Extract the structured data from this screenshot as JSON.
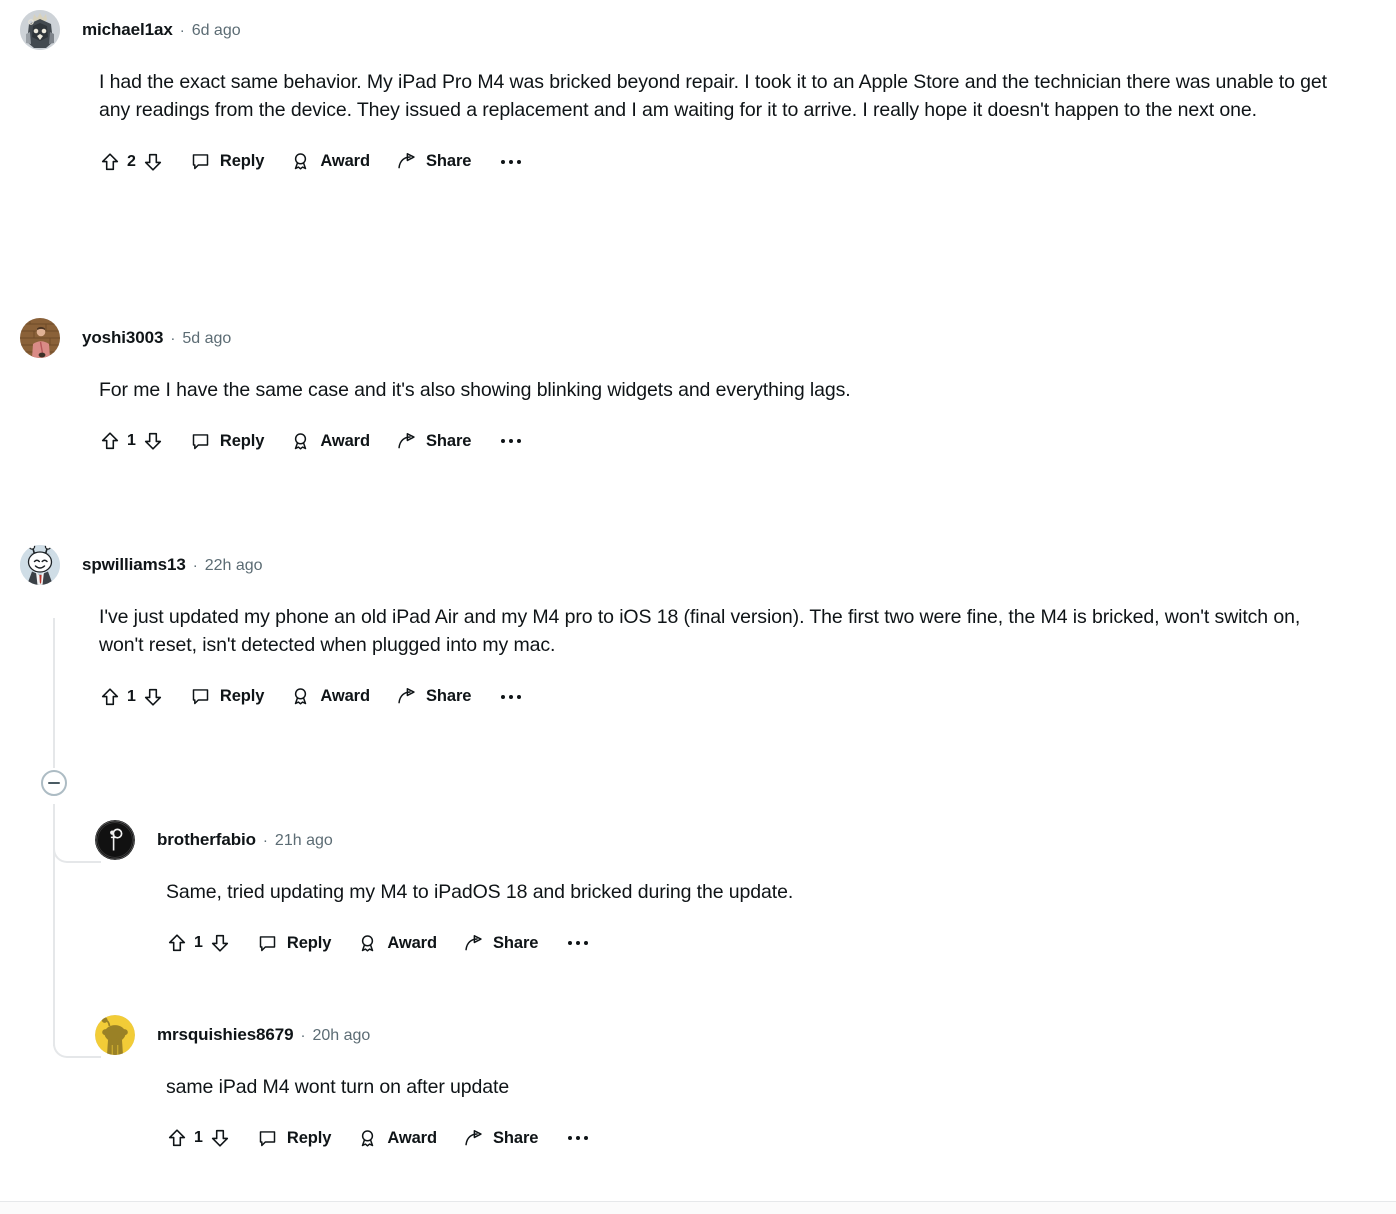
{
  "app": {
    "name": "reddit-comment-thread"
  },
  "action_labels": {
    "reply": "Reply",
    "award": "Award",
    "share": "Share",
    "more": "•••"
  },
  "separator": "·",
  "comments": [
    {
      "id": "c1",
      "username": "michael1ax",
      "timestamp": "6d ago",
      "score": "2",
      "body": "I had the exact same behavior. My iPad Pro M4 was bricked beyond repair. I took it to an Apple Store and the technician there was unable to get any readings from the device. They issued a replacement and I am waiting for it to arrive. I really hope it doesn't happen to the next one.",
      "avatar": {
        "type": "art-dark-knight",
        "colors": [
          "#c7ccd1",
          "#3c4248",
          "#8e949a",
          "#e8e4d8"
        ]
      },
      "depth": 0,
      "reply": "Reply",
      "award": "Award",
      "share": "Share"
    },
    {
      "id": "c2",
      "username": "yoshi3003",
      "timestamp": "5d ago",
      "score": "1",
      "body": "For me I have the same case and it's also showing blinking widgets and everything lags.",
      "avatar": {
        "type": "photo-person-brick",
        "colors": [
          "#8a5f3c",
          "#d98b86",
          "#5b3a24"
        ]
      },
      "depth": 0,
      "reply": "Reply",
      "award": "Award",
      "share": "Share"
    },
    {
      "id": "c3",
      "username": "spwilliams13",
      "timestamp": "22h ago",
      "score": "1",
      "body": "I've just updated my phone an old iPad Air and my M4 pro to iOS 18 (final version). The first two were fine, the M4 is bricked, won't switch on, won't reset, isn't detected when plugged into my mac.",
      "avatar": {
        "type": "snoo-suit",
        "colors": [
          "#c8d7e0",
          "#ffffff",
          "#2a2f33",
          "#c0392b"
        ]
      },
      "depth": 0,
      "collapsible": true,
      "reply": "Reply",
      "award": "Award",
      "share": "Share"
    },
    {
      "id": "c4",
      "username": "brotherfabio",
      "timestamp": "21h ago",
      "score": "1",
      "body": "Same, tried updating my M4 to iPadOS 18 and bricked during the update.",
      "avatar": {
        "type": "black-mark",
        "colors": [
          "#111111",
          "#ffffff"
        ]
      },
      "depth": 1,
      "reply": "Reply",
      "award": "Award",
      "share": "Share"
    },
    {
      "id": "c5",
      "username": "mrsquishies8679",
      "timestamp": "20h ago",
      "score": "1",
      "body": "same iPad M4 wont turn on after update",
      "avatar": {
        "type": "snoo-yellow",
        "colors": [
          "#f2cc37",
          "#9a8126"
        ]
      },
      "depth": 1,
      "reply": "Reply",
      "award": "Award",
      "share": "Share"
    }
  ],
  "icons": {
    "upvote": "upvote-arrow-icon",
    "downvote": "downvote-arrow-icon",
    "reply": "speech-bubble-icon",
    "award": "award-ribbon-icon",
    "share": "share-arrow-icon",
    "overflow": "overflow-dots-icon",
    "collapse": "collapse-thread-icon"
  },
  "colors": {
    "text": "#0f1417",
    "meta": "#5c6c74",
    "thread_line": "#e5e7e9",
    "background": "#ffffff"
  }
}
